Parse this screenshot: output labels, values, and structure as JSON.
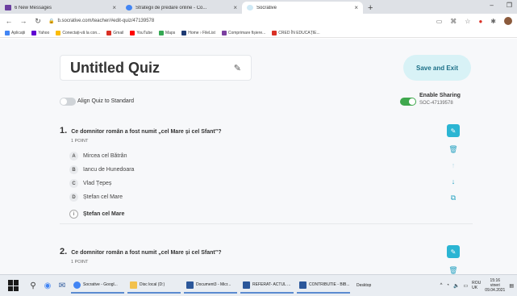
{
  "browser": {
    "tabs": [
      {
        "label": "6 New Messages",
        "color": "#6b3fa0"
      },
      {
        "label": "Strategii de predare online - Co...",
        "color": "#4285f4"
      },
      {
        "label": "Socrative",
        "color": "#e8f4fa"
      }
    ],
    "new_tab": "+",
    "url": "b.socrative.com/teacher/#edit-quiz/47139578",
    "bookmarks": [
      {
        "label": "Aplicații",
        "color": "#4285f4"
      },
      {
        "label": "Yahoo",
        "color": "#6001d2"
      },
      {
        "label": "Conectați-vă la con...",
        "color": "#fbbc05"
      },
      {
        "label": "Gmail",
        "color": "#d93025"
      },
      {
        "label": "YouTube",
        "color": "#ff0000"
      },
      {
        "label": "Maps",
        "color": "#34a853"
      },
      {
        "label": "Home › FileList",
        "color": "#1f3b73"
      },
      {
        "label": "Comprimare fișiere...",
        "color": "#7b3fa0"
      },
      {
        "label": "CRED ÎN EDUCAȚIE...",
        "color": "#d93025"
      }
    ]
  },
  "quiz": {
    "title": "Untitled Quiz",
    "save_exit": "Save and Exit",
    "align_label": "Align Quiz to Standard",
    "sharing_label": "Enable Sharing",
    "sharing_code": "SOC-47139578",
    "questions": [
      {
        "number": "1.",
        "text": "Ce domnitor român a fost numit „cel Mare  și cel Sfant”?",
        "points": "1 POINT",
        "answers": [
          {
            "letter": "A",
            "text": "Mircea cel Bătrân"
          },
          {
            "letter": "B",
            "text": "Iancu de Hunedoara"
          },
          {
            "letter": "C",
            "text": "Vlad Țepeș"
          },
          {
            "letter": "D",
            "text": "Ștefan cel Mare"
          }
        ],
        "correct_marker": "i",
        "correct_text": "Ștefan cel Mare"
      },
      {
        "number": "2.",
        "text": "Ce domnitor român a fost numit „cel Mare  și cel Sfant”?",
        "points": "1 POINT"
      }
    ]
  },
  "taskbar": {
    "apps": [
      {
        "label": "Socrative - Googl...",
        "color": "#4285f4"
      },
      {
        "label": "Disc local (D:)",
        "color": "#f2c14e"
      },
      {
        "label": "Document3 - Micr...",
        "color": "#2b579a"
      },
      {
        "label": "REFERAT- ACTUL ...",
        "color": "#2b579a"
      },
      {
        "label": "CONTRIBUTIE - BIB...",
        "color": "#2b579a"
      }
    ],
    "desktop_label": "Desktop",
    "lang": [
      "ROU",
      "UK"
    ],
    "time": "15:16",
    "day": "vineri",
    "date": "09.04.2021"
  }
}
